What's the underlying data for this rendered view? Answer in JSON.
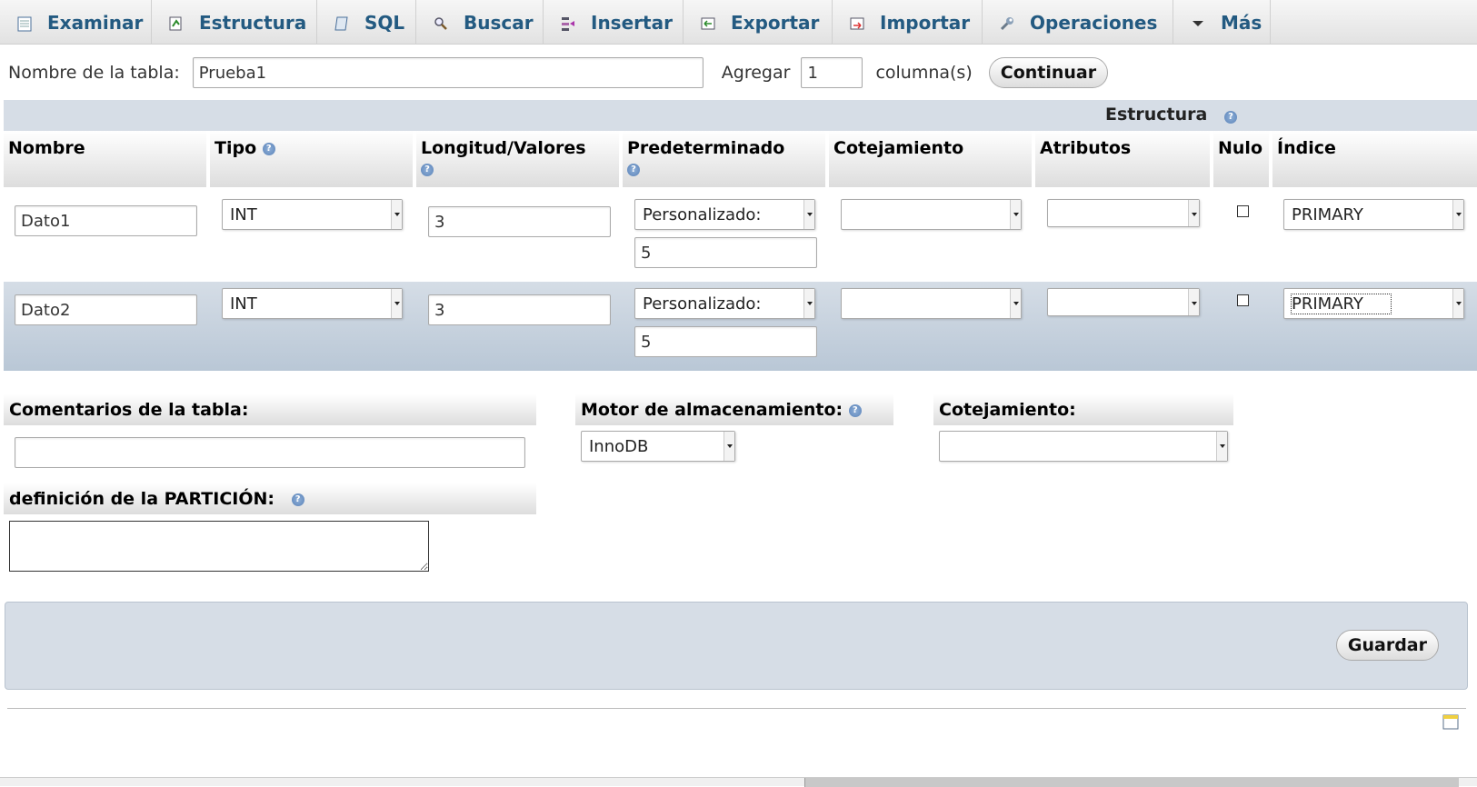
{
  "tabs": [
    {
      "label": "Examinar",
      "icon": "browse-icon"
    },
    {
      "label": "Estructura",
      "icon": "structure-icon"
    },
    {
      "label": "SQL",
      "icon": "sql-icon"
    },
    {
      "label": "Buscar",
      "icon": "search-icon"
    },
    {
      "label": "Insertar",
      "icon": "insert-icon"
    },
    {
      "label": "Exportar",
      "icon": "export-icon"
    },
    {
      "label": "Importar",
      "icon": "import-icon"
    },
    {
      "label": "Operaciones",
      "icon": "wrench-icon"
    },
    {
      "label": "Más",
      "icon": "chevron-down-icon"
    }
  ],
  "table_form": {
    "name_label": "Nombre de la tabla:",
    "name_value": "Prueba1",
    "add_label": "Agregar",
    "add_value": "1",
    "columns_label": "columna(s)",
    "continue_label": "Continuar"
  },
  "structure": {
    "band_label": "Estructura",
    "headers": {
      "nombre": "Nombre",
      "tipo": "Tipo",
      "longitud": "Longitud/Valores",
      "predeterminado": "Predeterminado",
      "cotejamiento": "Cotejamiento",
      "atributos": "Atributos",
      "nulo": "Nulo",
      "indice": "Índice"
    },
    "rows": [
      {
        "name": "Dato1",
        "type": "INT",
        "length": "3",
        "default": "Personalizado:",
        "default_value": "5",
        "collation": "",
        "attributes": "",
        "index": "PRIMARY"
      },
      {
        "name": "Dato2",
        "type": "INT",
        "length": "3",
        "default": "Personalizado:",
        "default_value": "5",
        "collation": "",
        "attributes": "",
        "index": "PRIMARY"
      }
    ]
  },
  "options": {
    "comments_label": "Comentarios de la tabla:",
    "comments_value": "",
    "engine_label": "Motor de almacenamiento:",
    "engine_value": "InnoDB",
    "collation_label": "Cotejamiento:",
    "collation_value": "",
    "partition_label": "definición de la PARTICIÓN:",
    "partition_value": ""
  },
  "save_label": "Guardar",
  "colors": {
    "tab_text": "#235a81",
    "band": "#d6dde6",
    "row_alt": "#c2cfdc"
  }
}
